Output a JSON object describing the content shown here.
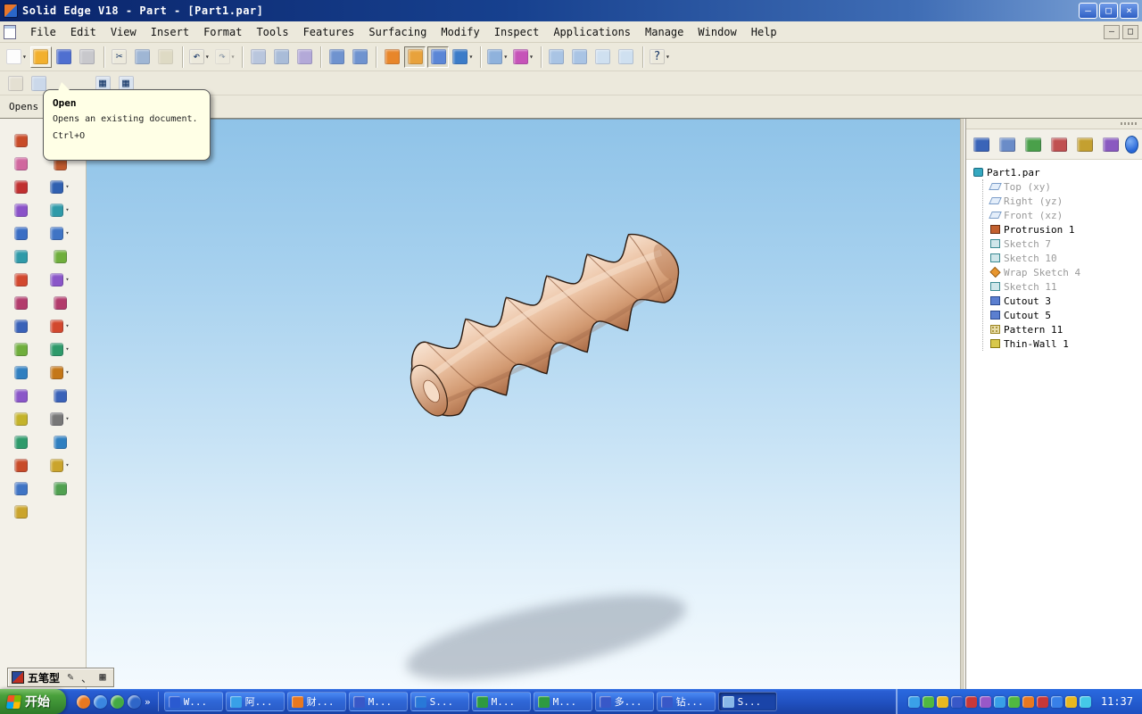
{
  "window": {
    "title": "Solid Edge V18 - Part - [Part1.par]",
    "controls": [
      {
        "name": "minimize-button",
        "glyph": "–"
      },
      {
        "name": "restore-button",
        "glyph": "□"
      },
      {
        "name": "close-button",
        "glyph": "×"
      }
    ],
    "mdi_controls": [
      {
        "name": "mdi-minimize-button",
        "glyph": "–"
      },
      {
        "name": "mdi-restore-button",
        "glyph": "□"
      }
    ]
  },
  "menu": {
    "items": [
      {
        "label": "File"
      },
      {
        "label": "Edit"
      },
      {
        "label": "View"
      },
      {
        "label": "Insert"
      },
      {
        "label": "Format"
      },
      {
        "label": "Tools"
      },
      {
        "label": "Features"
      },
      {
        "label": "Surfacing"
      },
      {
        "label": "Modify"
      },
      {
        "label": "Inspect"
      },
      {
        "label": "Applications"
      },
      {
        "label": "Manage"
      },
      {
        "label": "Window"
      },
      {
        "label": "Help"
      }
    ]
  },
  "toolbar_main": {
    "buttons": [
      {
        "name": "new-button",
        "color": "#fdfdfd",
        "glyph": "",
        "state": "",
        "drop": "drop",
        "inter": "true"
      },
      {
        "name": "open-button",
        "color": "#f2b02e",
        "glyph": "",
        "state": "hover",
        "drop": "",
        "inter": "true"
      },
      {
        "name": "save-button",
        "color": "#4f6fd0",
        "glyph": "",
        "state": "",
        "drop": "",
        "inter": "true"
      },
      {
        "name": "print-button",
        "color": "#c8c8cc",
        "glyph": "",
        "state": "",
        "drop": "",
        "inter": "true"
      },
      {
        "name": "toolbar-separator",
        "state": "sep",
        "inter": "false"
      },
      {
        "name": "cut-button",
        "color": "",
        "glyph": "✂",
        "state": "",
        "drop": "",
        "inter": "true"
      },
      {
        "name": "copy-button",
        "color": "#9fb6d4",
        "glyph": "",
        "state": "",
        "drop": "",
        "inter": "true"
      },
      {
        "name": "paste-button",
        "color": "#cfc9a8",
        "glyph": "",
        "state": "disabled",
        "drop": "",
        "inter": "true"
      },
      {
        "name": "toolbar-separator",
        "state": "sep",
        "inter": "false"
      },
      {
        "name": "undo-button",
        "color": "",
        "glyph": "↶",
        "state": "",
        "drop": "drop",
        "inter": "true"
      },
      {
        "name": "redo-button",
        "color": "",
        "glyph": "↷",
        "state": "disabled",
        "drop": "drop",
        "inter": "true"
      },
      {
        "name": "toolbar-separator",
        "state": "sep",
        "inter": "false"
      },
      {
        "name": "insert-object-button",
        "color": "#b9c6dd",
        "glyph": "",
        "state": "",
        "drop": "",
        "inter": "true"
      },
      {
        "name": "links-button",
        "color": "#a9bcd8",
        "glyph": "",
        "state": "",
        "drop": "",
        "inter": "true"
      },
      {
        "name": "image-button",
        "color": "#b3a9d8",
        "glyph": "",
        "state": "",
        "drop": "",
        "inter": "true"
      },
      {
        "name": "toolbar-separator",
        "state": "sep",
        "inter": "false"
      },
      {
        "name": "isometric-view-button",
        "color": "#6f93cf",
        "glyph": "",
        "state": "",
        "drop": "",
        "inter": "true"
      },
      {
        "name": "dimetric-view-button",
        "color": "#6f93cf",
        "glyph": "",
        "state": "",
        "drop": "",
        "inter": "true"
      },
      {
        "name": "toolbar-separator",
        "state": "sep",
        "inter": "false"
      },
      {
        "name": "sketch-view-button",
        "color": "#e8862a",
        "glyph": "",
        "state": "",
        "drop": "",
        "inter": "true"
      },
      {
        "name": "shaded-toggle",
        "color": "#e8a23c",
        "glyph": "",
        "state": "pressed",
        "drop": "",
        "inter": "true"
      },
      {
        "name": "shaded-edges-toggle",
        "color": "#5b86d6",
        "glyph": "",
        "state": "pressed",
        "drop": "",
        "inter": "true"
      },
      {
        "name": "rotate-view-button",
        "color": "#3c7cc8",
        "glyph": "",
        "state": "",
        "drop": "drop",
        "inter": "true"
      },
      {
        "name": "toolbar-separator",
        "state": "sep",
        "inter": "false"
      },
      {
        "name": "display-options-button",
        "color": "#8fb2dc",
        "glyph": "",
        "state": "",
        "drop": "drop",
        "inter": "true"
      },
      {
        "name": "update-views-button",
        "color": "#c653b8",
        "glyph": "",
        "state": "",
        "drop": "drop",
        "inter": "true"
      },
      {
        "name": "toolbar-separator",
        "state": "sep",
        "inter": "false"
      },
      {
        "name": "zoom-area-button",
        "color": "#a9c4e4",
        "glyph": "",
        "state": "",
        "drop": "",
        "inter": "true"
      },
      {
        "name": "zoom-button",
        "color": "#a9c4e4",
        "glyph": "",
        "state": "",
        "drop": "",
        "inter": "true"
      },
      {
        "name": "fit-view-button",
        "color": "#cfe0f0",
        "glyph": "",
        "state": "",
        "drop": "",
        "inter": "true"
      },
      {
        "name": "pan-button",
        "color": "#cfe0f0",
        "glyph": "",
        "state": "",
        "drop": "",
        "inter": "true"
      },
      {
        "name": "toolbar-separator",
        "state": "sep",
        "inter": "false"
      },
      {
        "name": "help-button",
        "color": "",
        "glyph": "?",
        "state": "",
        "drop": "drop",
        "inter": "true"
      }
    ]
  },
  "toolbar_second": {
    "buttons": [
      {
        "name": "select-arrow-button",
        "color": "#e4e0d2",
        "glyph": "",
        "state": "",
        "drop": "",
        "inter": "true"
      },
      {
        "name": "sketch-mode-button",
        "color": "#cbd8ea",
        "glyph": "",
        "state": "",
        "drop": "",
        "inter": "true"
      },
      {
        "name": "toolbar-gap",
        "state": "gap",
        "inter": "false"
      },
      {
        "name": "view-layout-button-1",
        "color": "#d8e2ee",
        "glyph": "▦",
        "state": "",
        "drop": "",
        "inter": "true"
      },
      {
        "name": "view-layout-button-2",
        "color": "#d8e2ee",
        "glyph": "▦",
        "state": "",
        "drop": "",
        "inter": "true"
      }
    ]
  },
  "prompt": {
    "text": "Opens"
  },
  "tooltip": {
    "title": "Open",
    "description": "Opens an existing document.",
    "shortcut": "Ctrl+O"
  },
  "left_toolbar_a": {
    "buttons": [
      {
        "name": "protrusion-button",
        "color": "#c84b28",
        "drop": ""
      },
      {
        "name": "revolved-protrusion-button",
        "color": "#d0679e",
        "drop": ""
      },
      {
        "name": "cutout-button",
        "color": "#c03030",
        "drop": ""
      },
      {
        "name": "revolved-cutout-button",
        "color": "#8a52c8",
        "drop": ""
      },
      {
        "name": "hole-button",
        "color": "#3a6ec4",
        "drop": ""
      },
      {
        "name": "thread-button",
        "color": "#2f9aa8",
        "drop": ""
      },
      {
        "name": "round-button",
        "color": "#d2482e",
        "drop": ""
      },
      {
        "name": "chamfer-button",
        "color": "#b23b6b",
        "drop": ""
      },
      {
        "name": "draft-button",
        "color": "#3a62b8",
        "drop": ""
      },
      {
        "name": "thin-wall-button",
        "color": "#6fae3c",
        "drop": ""
      },
      {
        "name": "rib-button",
        "color": "#2f7fc0",
        "drop": ""
      },
      {
        "name": "pattern-button",
        "color": "#8a56c8",
        "drop": ""
      },
      {
        "name": "mirror-button",
        "color": "#c4b32a",
        "drop": ""
      },
      {
        "name": "helix-button",
        "color": "#2e9a6a",
        "drop": ""
      },
      {
        "name": "sweep-button",
        "color": "#c84b28",
        "drop": ""
      },
      {
        "name": "loft-button",
        "color": "#3f74c4",
        "drop": ""
      },
      {
        "name": "material-button",
        "color": "#caa42c",
        "drop": ""
      }
    ]
  },
  "left_toolbar_b": {
    "buttons": [
      {
        "name": "smart-dimension-button",
        "color": "#3a8ec0",
        "drop": "drop"
      },
      {
        "name": "sketch-button",
        "color": "#c05a2e",
        "drop": ""
      },
      {
        "name": "line-tool-button",
        "color": "#3060b0",
        "drop": "drop"
      },
      {
        "name": "arc-tool-button",
        "color": "#2f9aa8",
        "drop": "drop"
      },
      {
        "name": "circle-tool-button",
        "color": "#3f74c4",
        "drop": "drop"
      },
      {
        "name": "rectangle-tool-button",
        "color": "#6fae3c",
        "drop": ""
      },
      {
        "name": "curve-tool-button",
        "color": "#8a56c8",
        "drop": "drop"
      },
      {
        "name": "point-tool-button",
        "color": "#b23b6b",
        "drop": ""
      },
      {
        "name": "fillet-tool-button",
        "color": "#d2482e",
        "drop": "drop"
      },
      {
        "name": "trim-tool-button",
        "color": "#2e9a6a",
        "drop": "drop"
      },
      {
        "name": "offset-tool-button",
        "color": "#c47718",
        "drop": "drop"
      },
      {
        "name": "project-edges-button",
        "color": "#3a62b8",
        "drop": ""
      },
      {
        "name": "construction-button",
        "color": "#777777",
        "drop": "drop"
      },
      {
        "name": "dimension-axis-button",
        "color": "#2f7fc0",
        "drop": ""
      },
      {
        "name": "relationship-button",
        "color": "#caa42c",
        "drop": "drop"
      },
      {
        "name": "grid-button",
        "color": "#50a050",
        "drop": ""
      }
    ]
  },
  "edgebar": {
    "toolbar": [
      {
        "name": "feature-pathfinder-tab",
        "color": "#3a64b8"
      },
      {
        "name": "family-of-parts-tab",
        "color": "#6a8cc8"
      },
      {
        "name": "layers-tab",
        "color": "#4aa04a"
      },
      {
        "name": "sensors-tab",
        "color": "#c05050"
      },
      {
        "name": "feature-library-tab",
        "color": "#c4a030"
      },
      {
        "name": "simulation-tab",
        "color": "#8a5ac0"
      }
    ],
    "tree": {
      "root": {
        "label": "Part1.par"
      },
      "items": [
        {
          "label": "Top (xy)",
          "icon": "ic-plane",
          "state": "dim"
        },
        {
          "label": "Right (yz)",
          "icon": "ic-plane",
          "state": "dim"
        },
        {
          "label": "Front (xz)",
          "icon": "ic-plane",
          "state": "dim"
        },
        {
          "label": "Protrusion 1",
          "icon": "ic-protrusion",
          "state": ""
        },
        {
          "label": "Sketch 7",
          "icon": "ic-sketch",
          "state": "dim"
        },
        {
          "label": "Sketch 10",
          "icon": "ic-sketch",
          "state": "dim"
        },
        {
          "label": "Wrap Sketch 4",
          "icon": "ic-wrap",
          "state": "dim"
        },
        {
          "label": "Sketch 11",
          "icon": "ic-sketch",
          "state": "dim"
        },
        {
          "label": "Cutout 3",
          "icon": "ic-cutout",
          "state": ""
        },
        {
          "label": "Cutout 5",
          "icon": "ic-cutout",
          "state": ""
        },
        {
          "label": "Pattern 11",
          "icon": "ic-pattern",
          "state": ""
        },
        {
          "label": "Thin-Wall 1",
          "icon": "ic-thinwall",
          "state": ""
        }
      ]
    }
  },
  "ime": {
    "label": "五笔型",
    "icons": [
      {
        "name": "pen-icon",
        "glyph": "✎"
      },
      {
        "name": "punctuation-icon",
        "glyph": "、"
      },
      {
        "name": "keyboard-icon",
        "glyph": "▦"
      }
    ]
  },
  "taskbar": {
    "start_label": "开始",
    "overflow": "»",
    "quick_launch": [
      {
        "name": "quick-launch-media-player",
        "color": "#e87820"
      },
      {
        "name": "quick-launch-browser",
        "color": "#3a86e0"
      },
      {
        "name": "quick-launch-messenger",
        "color": "#44aa44"
      },
      {
        "name": "quick-launch-desktop",
        "color": "#2f66c8"
      }
    ],
    "tasks": [
      {
        "label": "W...",
        "color": "#2a5ad0",
        "state": ""
      },
      {
        "label": "阿...",
        "color": "#38a0e8",
        "state": ""
      },
      {
        "label": "财...",
        "color": "#e87820",
        "state": ""
      },
      {
        "label": "M...",
        "color": "#3858c8",
        "state": ""
      },
      {
        "label": "S...",
        "color": "#2878d8",
        "state": ""
      },
      {
        "label": "M...",
        "color": "#2e9a40",
        "state": ""
      },
      {
        "label": "M...",
        "color": "#2e9a40",
        "state": ""
      },
      {
        "label": "多...",
        "color": "#3858c8",
        "state": ""
      },
      {
        "label": "钻...",
        "color": "#3858c8",
        "state": ""
      },
      {
        "label": "S...",
        "color": "#88b8e8",
        "state": "active"
      }
    ],
    "tray": [
      {
        "name": "tray-icon-1",
        "color": "#3aa0e8"
      },
      {
        "name": "tray-icon-2",
        "color": "#50b840"
      },
      {
        "name": "tray-icon-3",
        "color": "#e8b820"
      },
      {
        "name": "tray-icon-4",
        "color": "#3858c8"
      },
      {
        "name": "tray-icon-5",
        "color": "#c83838"
      },
      {
        "name": "tray-icon-6",
        "color": "#9858c8"
      },
      {
        "name": "tray-icon-7",
        "color": "#38a0e8"
      },
      {
        "name": "tray-icon-8",
        "color": "#50b840"
      },
      {
        "name": "tray-icon-9",
        "color": "#e87820"
      },
      {
        "name": "tray-icon-10",
        "color": "#c83838"
      },
      {
        "name": "tray-icon-11",
        "color": "#3880e8"
      },
      {
        "name": "tray-icon-12",
        "color": "#e8b820"
      },
      {
        "name": "tray-icon-13",
        "color": "#44c8e8"
      }
    ],
    "clock": "11:37"
  }
}
